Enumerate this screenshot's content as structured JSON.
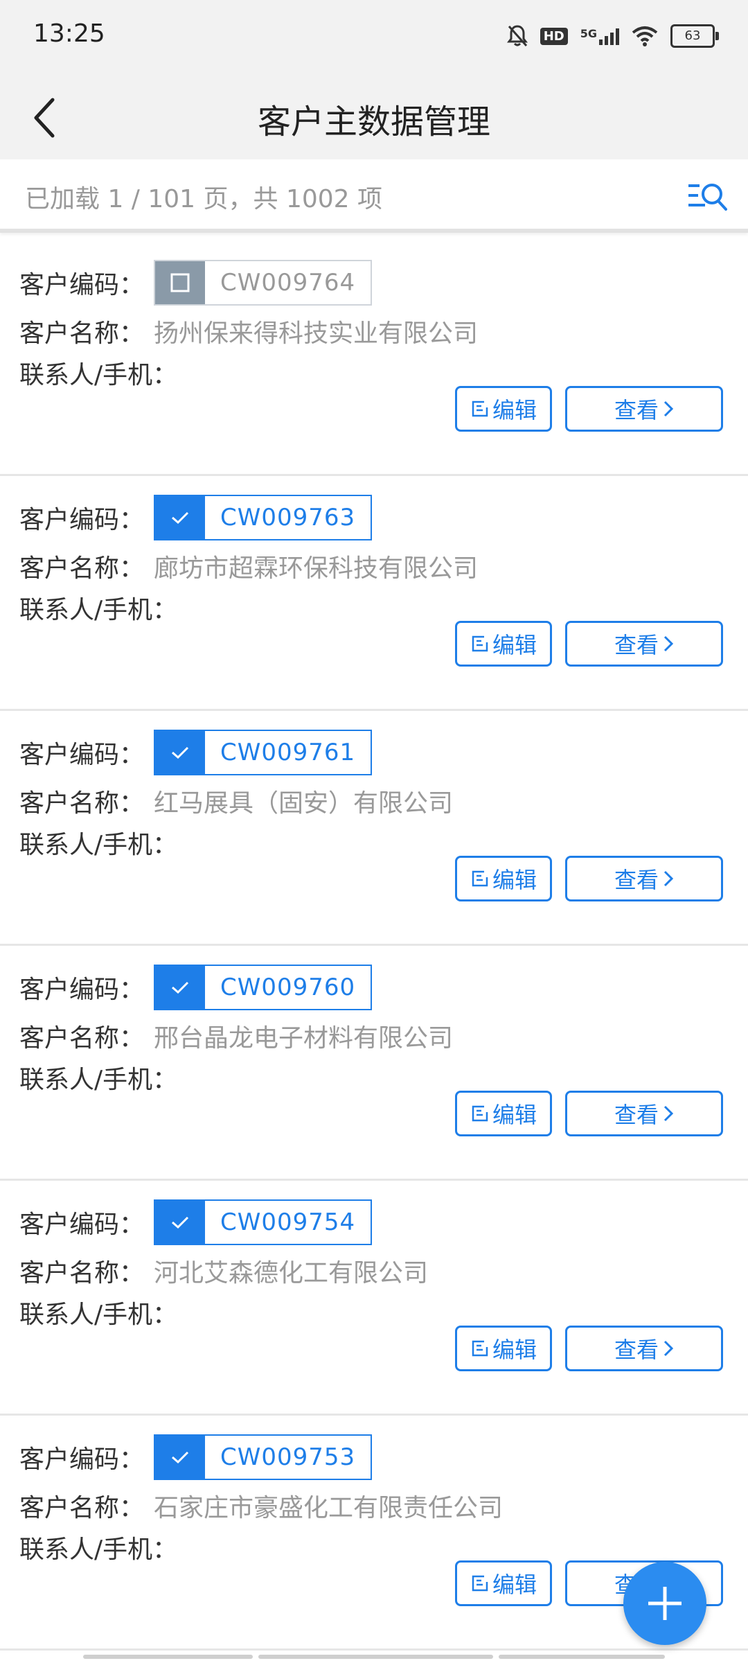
{
  "status_bar": {
    "time": "13:25",
    "hd_label": "HD",
    "network_label": "5G",
    "battery_level": "63"
  },
  "header": {
    "title": "客户主数据管理",
    "back_icon": "chevron-left-icon"
  },
  "info_bar": {
    "load_text": "已加载 1 / 101 页，共 1002 项",
    "filter_icon": "filter-search-icon"
  },
  "labels": {
    "code": "客户编码：",
    "name": "客户名称：",
    "contact": "联系人/手机："
  },
  "buttons": {
    "edit": "编辑",
    "view": "查看"
  },
  "customers": [
    {
      "code": "CW009764",
      "name": "扬州保来得科技实业有限公司",
      "contact": "",
      "checked": false
    },
    {
      "code": "CW009763",
      "name": "廊坊市超霖环保科技有限公司",
      "contact": "",
      "checked": true
    },
    {
      "code": "CW009761",
      "name": "红马展具（固安）有限公司",
      "contact": "",
      "checked": true
    },
    {
      "code": "CW009760",
      "name": "邢台晶龙电子材料有限公司",
      "contact": "",
      "checked": true
    },
    {
      "code": "CW009754",
      "name": "河北艾森德化工有限公司",
      "contact": "",
      "checked": true
    },
    {
      "code": "CW009753",
      "name": "石家庄市豪盛化工有限责任公司",
      "contact": "",
      "checked": true
    }
  ],
  "fab": {
    "icon": "plus-icon"
  },
  "colors": {
    "accent": "#1e7ee8",
    "fab": "#2b8cf0",
    "header_bg": "#f2f2f2",
    "unchecked": "#8a9aa8"
  }
}
